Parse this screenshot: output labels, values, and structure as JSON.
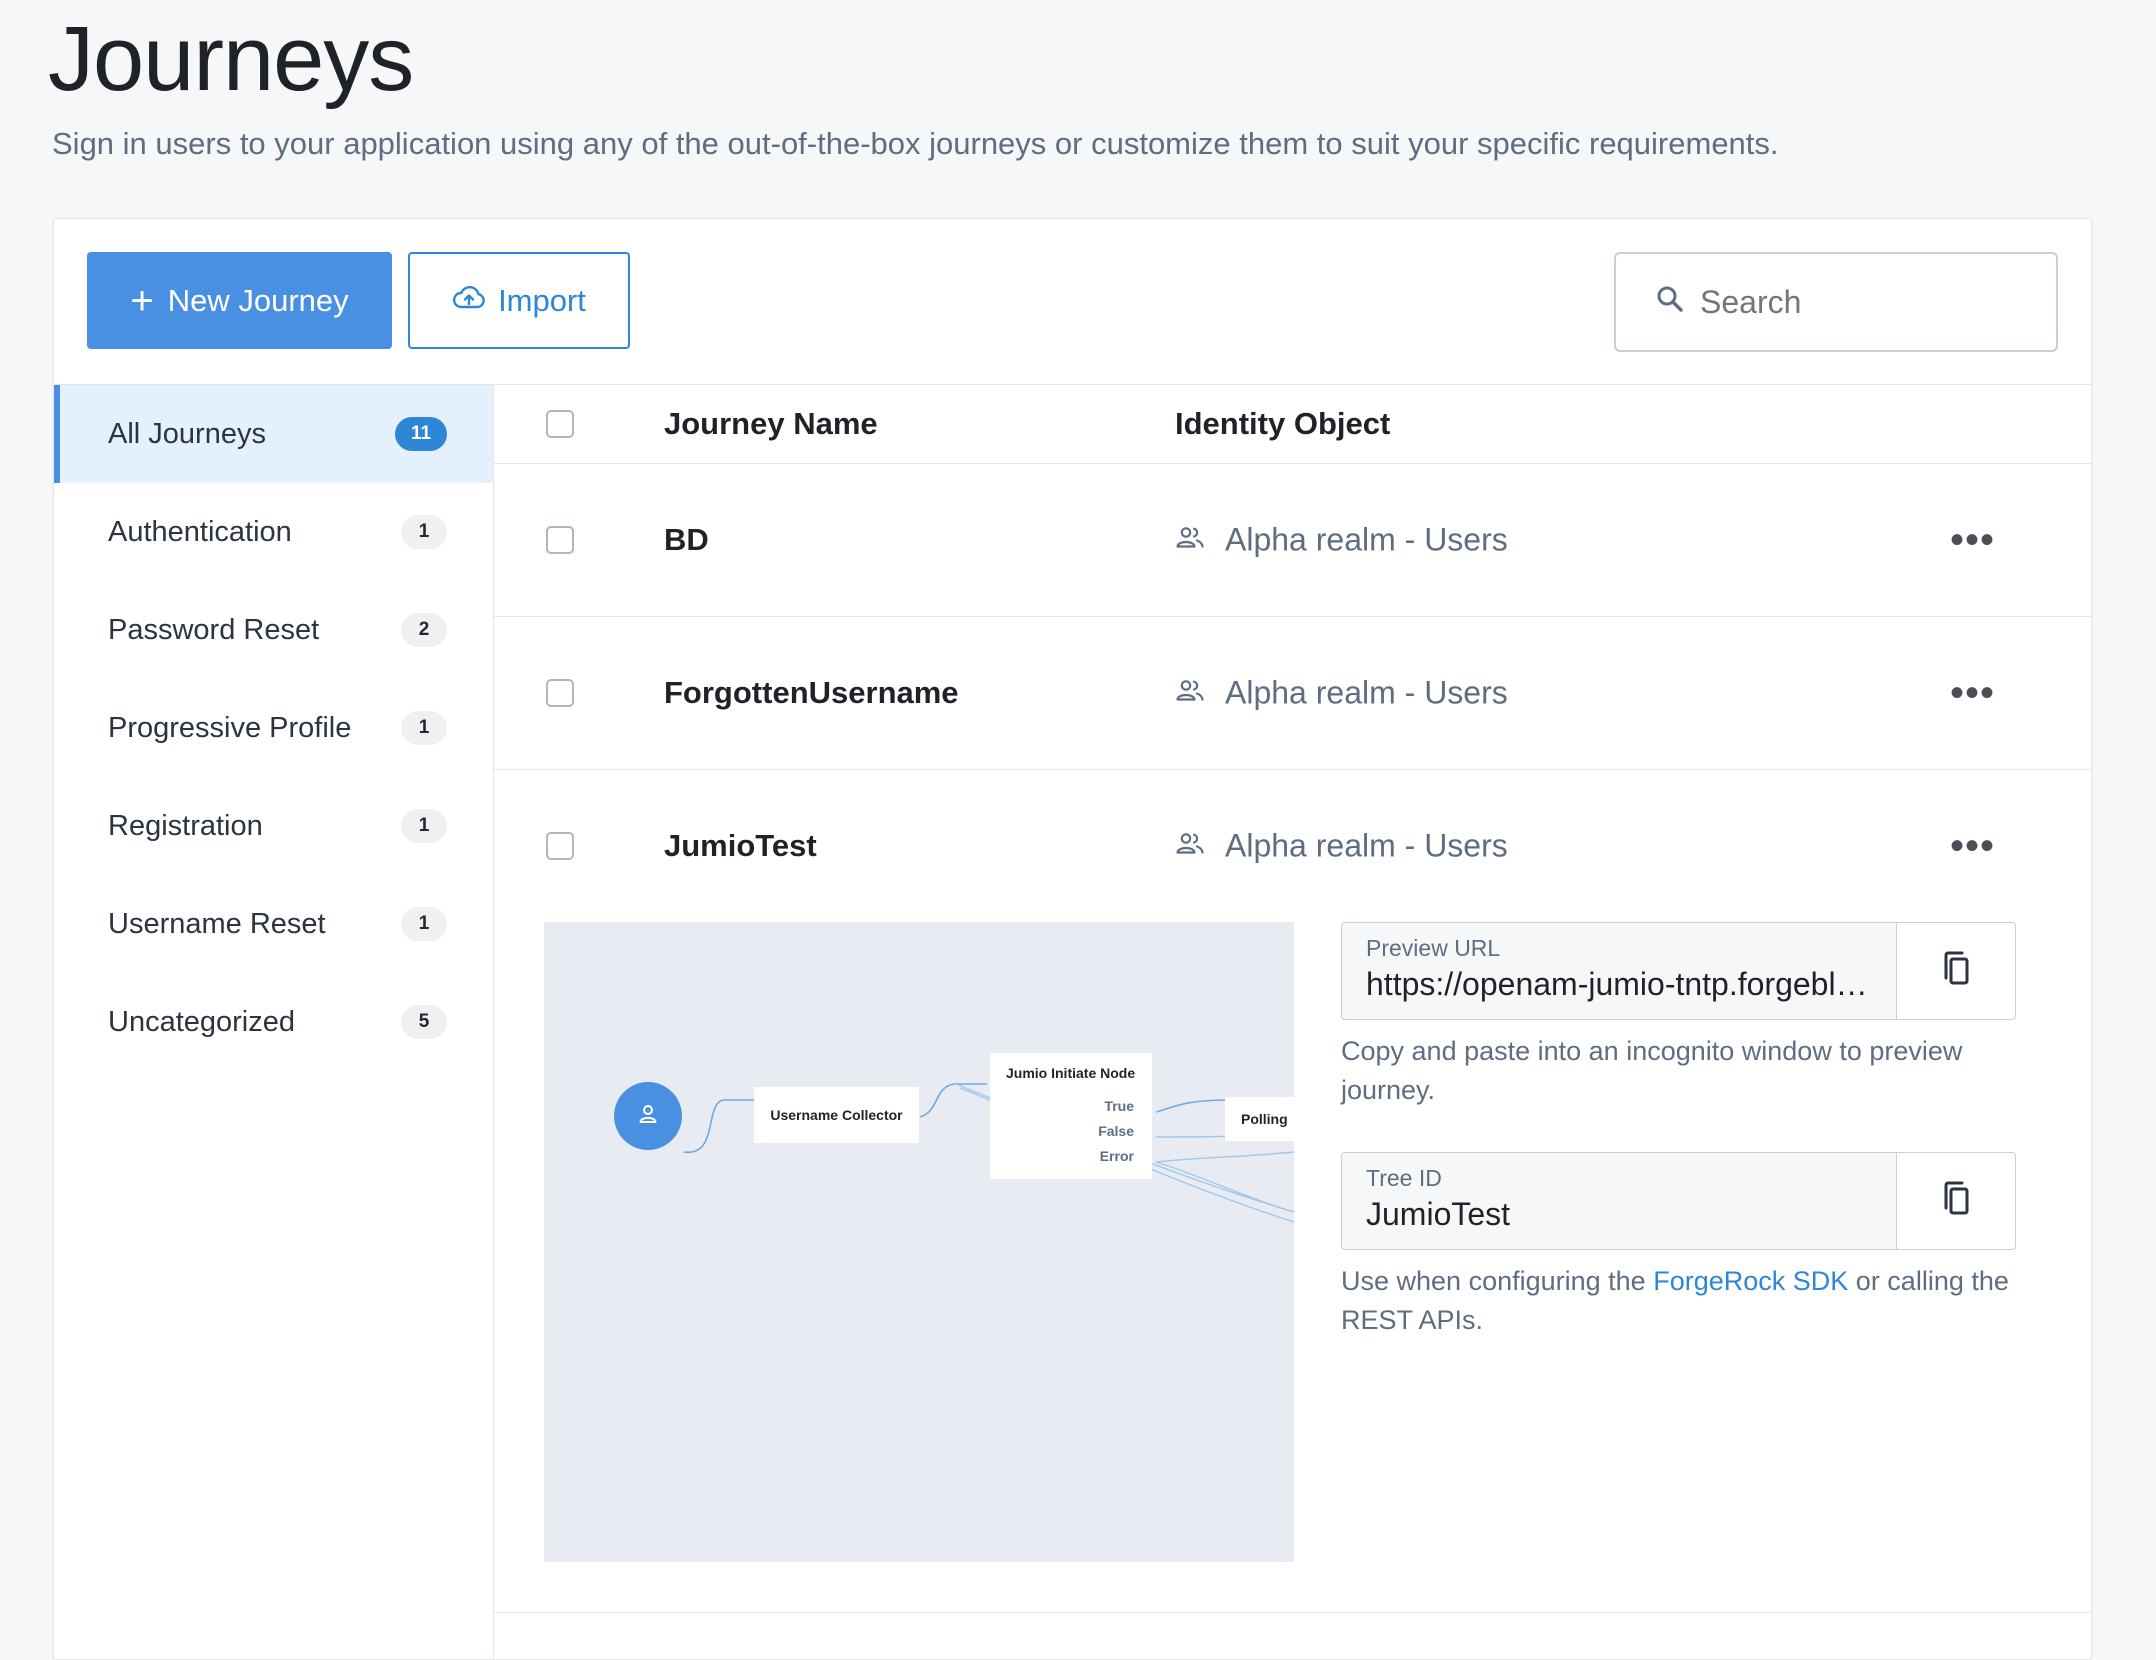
{
  "page": {
    "title": "Journeys",
    "subtitle": "Sign in users to your application using any of the out-of-the-box journeys or customize them to suit your specific requirements."
  },
  "toolbar": {
    "new_journey_label": "New Journey",
    "import_label": "Import",
    "search_placeholder": "Search"
  },
  "sidebar": {
    "items": [
      {
        "label": "All Journeys",
        "count": "11",
        "active": true
      },
      {
        "label": "Authentication",
        "count": "1"
      },
      {
        "label": "Password Reset",
        "count": "2"
      },
      {
        "label": "Progressive Profile",
        "count": "1"
      },
      {
        "label": "Registration",
        "count": "1"
      },
      {
        "label": "Username Reset",
        "count": "1"
      },
      {
        "label": "Uncategorized",
        "count": "5"
      }
    ]
  },
  "table": {
    "headers": {
      "name": "Journey Name",
      "identity": "Identity Object"
    },
    "rows": [
      {
        "name": "BD",
        "identity": "Alpha realm - Users"
      },
      {
        "name": "ForgottenUsername",
        "identity": "Alpha realm - Users"
      },
      {
        "name": "JumioTest",
        "identity": "Alpha realm - Users"
      }
    ]
  },
  "expanded": {
    "diagram": {
      "nodes": {
        "username_collector": "Username Collector",
        "jumio_initiate": "Jumio Initiate Node",
        "polling": "Polling"
      },
      "outcomes": [
        "True",
        "False",
        "Error"
      ]
    },
    "preview_url": {
      "label": "Preview URL",
      "value": "https://openam-jumio-tntp.forgeblo…",
      "hint": "Copy and paste into an incognito window to preview journey."
    },
    "tree_id": {
      "label": "Tree ID",
      "value": "JumioTest",
      "hint_prefix": "Use when configuring the",
      "hint_link": "ForgeRock SDK",
      "hint_suffix": "or calling the REST APIs."
    }
  },
  "colors": {
    "primary": "#4a90e2",
    "link": "#2e86d7",
    "active_bg": "#e4f0fb",
    "diagram_bg": "#e8ecf2"
  }
}
